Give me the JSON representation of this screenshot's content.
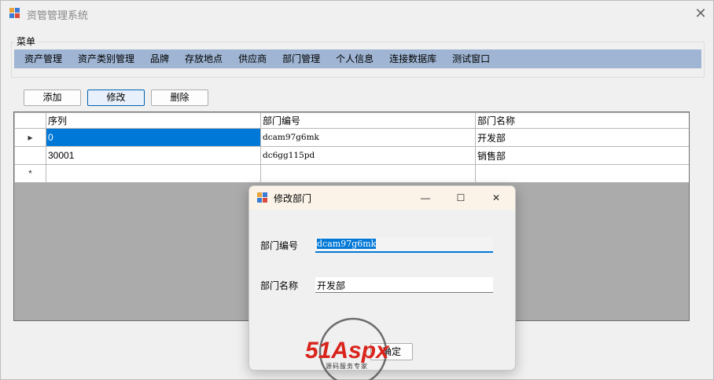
{
  "window": {
    "title": "资管管理系统",
    "icon": "app-icon",
    "close_glyph": "✕"
  },
  "menu": {
    "group_label": "菜单",
    "items": [
      "资产管理",
      "资产类别管理",
      "品牌",
      "存放地点",
      "供应商",
      "部门管理",
      "个人信息",
      "连接数据库",
      "测试窗口"
    ]
  },
  "toolbar": {
    "add_label": "添加",
    "edit_label": "修改",
    "delete_label": "删除"
  },
  "grid": {
    "columns": [
      "序列",
      "部门编号",
      "部门名称"
    ],
    "rows": [
      {
        "indicator": "▸",
        "seq": "0",
        "code": "dcam97g6mk",
        "name": "开发部"
      },
      {
        "indicator": "",
        "seq": "30001",
        "code": "dc6gg115pd",
        "name": "销售部"
      },
      {
        "indicator": "*",
        "seq": "",
        "code": "",
        "name": ""
      }
    ]
  },
  "dialog": {
    "title": "修改部门",
    "minimize_glyph": "—",
    "maximize_glyph": "☐",
    "close_glyph": "✕",
    "code_label": "部门编号",
    "code_value": "dcam97g6mk",
    "name_label": "部门名称",
    "name_value": "开发部",
    "ok_label": "确定"
  },
  "watermark": {
    "brand": "51Aspx",
    "tagline": "源码服务专家"
  },
  "colors": {
    "menubar": "#9fb5d3",
    "selection": "#0078d7",
    "grid_empty": "#ababab"
  }
}
